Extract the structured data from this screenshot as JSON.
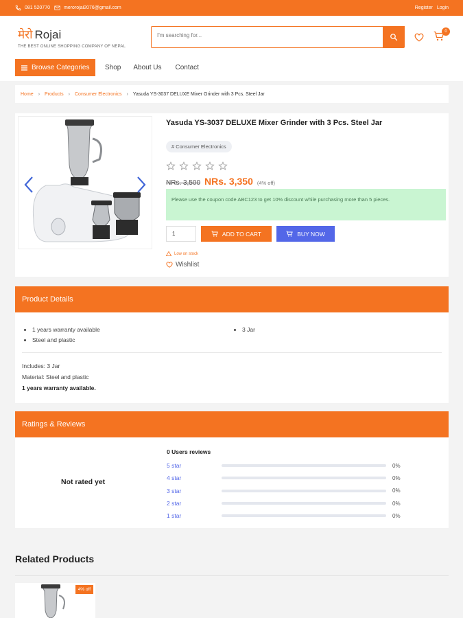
{
  "topbar": {
    "phone": "081 520770",
    "email": "merorojai2076@gmail.com",
    "register": "Register",
    "login": "Login"
  },
  "header": {
    "logo_dev": "मेरो",
    "logo_name": "Rojai",
    "tagline": "THE BEST ONLINE SHOPPING COMPANY OF NEPAL",
    "search_placeholder": "I'm searching for...",
    "cart_count": "0"
  },
  "nav": {
    "browse": "Browse Categories",
    "links": [
      "Shop",
      "About Us",
      "Contact"
    ]
  },
  "breadcrumb": {
    "items": [
      "Home",
      "Products",
      "Consumer Electronics",
      "Yasuda YS-3037 DELUXE Mixer Grinder with 3 Pcs. Steel Jar"
    ]
  },
  "product": {
    "title": "Yasuda YS-3037 DELUXE Mixer Grinder with 3 Pcs. Steel Jar",
    "category_tag": "# Consumer Electronics",
    "rating_stars": 0,
    "old_price": "NRs. 3,500",
    "new_price": "NRs. 3,350",
    "discount": "(4% off)",
    "coupon_text": "Please use the coupon code ABC123 to get 10% discount while purchasing more than 5 pieces.",
    "quantity": "1",
    "add_to_cart": "ADD TO CART",
    "buy_now": "BUY NOW",
    "stock_status": "Low on stock",
    "wishlist": "Wishlist"
  },
  "details": {
    "heading": "Product Details",
    "col1": [
      "1 years warranty available",
      "Steel and plastic"
    ],
    "col2": [
      "3 Jar"
    ],
    "includes": "Includes: 3 Jar",
    "material": "Material: Steel and plastic",
    "warranty_bold": "1 years warranty available."
  },
  "ratings": {
    "heading": "Ratings & Reviews",
    "not_rated": "Not rated yet",
    "users_reviews": "0 Users reviews",
    "rows": [
      {
        "label": "5 star",
        "pct": "0%",
        "value": 0
      },
      {
        "label": "4 star",
        "pct": "0%",
        "value": 0
      },
      {
        "label": "3 star",
        "pct": "0%",
        "value": 0
      },
      {
        "label": "2 star",
        "pct": "0%",
        "value": 0
      },
      {
        "label": "1 star",
        "pct": "0%",
        "value": 0
      }
    ]
  },
  "related": {
    "heading": "Related Products",
    "badge": "4% off"
  },
  "colors": {
    "accent": "#f47321",
    "buy": "#5367e8",
    "coupon_bg": "#c9f5d2"
  }
}
